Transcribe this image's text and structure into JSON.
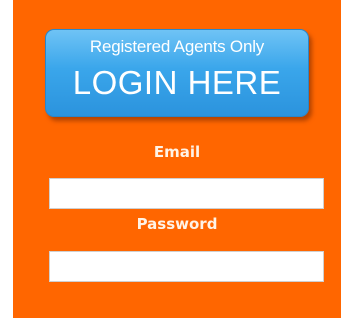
{
  "login_badge": {
    "line1": "Registered Agents Only",
    "line2": "LOGIN HERE"
  },
  "form": {
    "email_label": "Email",
    "email_value": "",
    "password_label": "Password",
    "password_value": ""
  },
  "colors": {
    "panel_background": "#ff6600",
    "badge_blue": "#3aa6eb",
    "label_text": "#fff3e6"
  }
}
